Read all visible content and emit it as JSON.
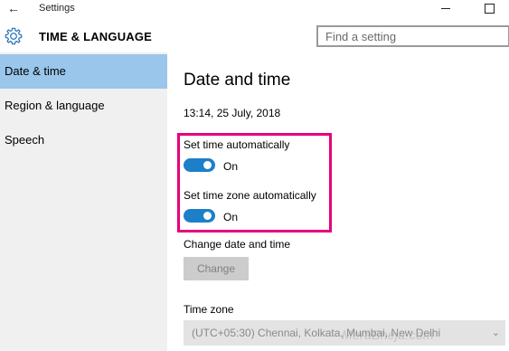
{
  "window": {
    "title": "Settings",
    "back_icon": "back-arrow-icon",
    "minimize_icon": "minimize-icon",
    "maximize_icon": "maximize-icon"
  },
  "header": {
    "icon": "gear-icon",
    "title": "TIME & LANGUAGE",
    "search_placeholder": "Find a setting"
  },
  "sidebar": {
    "items": [
      {
        "label": "Date & time",
        "active": true
      },
      {
        "label": "Region & language",
        "active": false
      },
      {
        "label": "Speech",
        "active": false
      }
    ],
    "active_color": "#99c6ea"
  },
  "main": {
    "title": "Date and time",
    "current_datetime": "13:14, 25 July, 2018",
    "set_time_auto": {
      "label": "Set time automatically",
      "state": "On"
    },
    "set_zone_auto": {
      "label": "Set time zone automatically",
      "state": "On"
    },
    "change_section_label": "Change date and time",
    "change_button": "Change",
    "timezone_label": "Time zone",
    "timezone_value": "(UTC+05:30) Chennai, Kolkata, Mumbai, New Delhi",
    "highlight_color": "#e6007e",
    "toggle_color": "#1e7fc9"
  },
  "watermark": "MeraBheja.com"
}
